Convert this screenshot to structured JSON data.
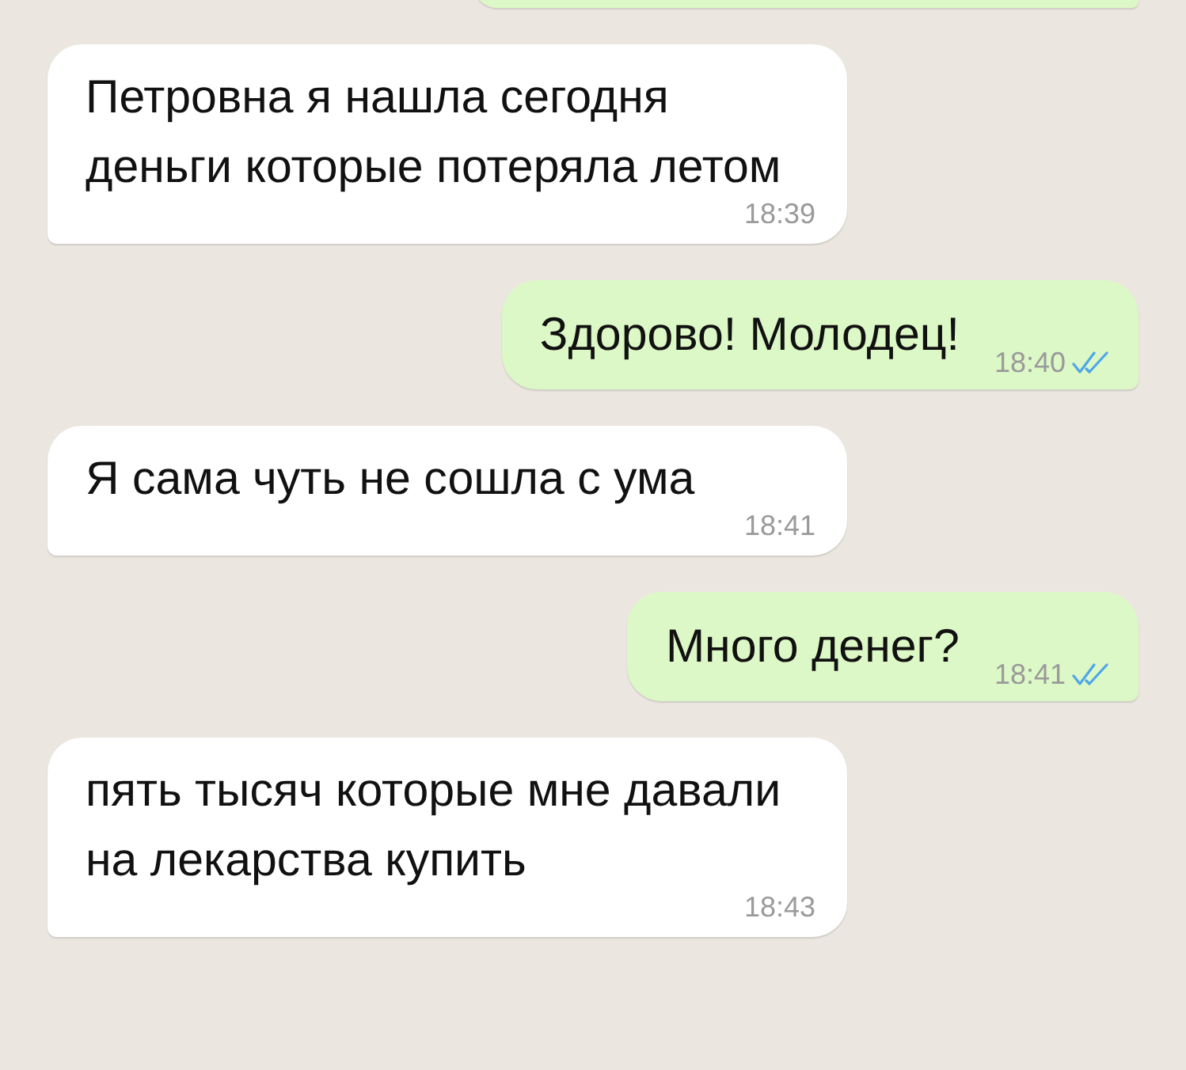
{
  "messages": [
    {
      "kind": "out",
      "cut_off": true
    },
    {
      "kind": "in",
      "text": "Петровна я нашла сегодня деньги которые потеряла летом",
      "time": "18:39"
    },
    {
      "kind": "out",
      "text": "Здорово! Молодец!",
      "time": "18:40",
      "read": true
    },
    {
      "kind": "in",
      "text": "Я сама чуть не сошла с ума",
      "time": "18:41"
    },
    {
      "kind": "out",
      "text": "Много денег?",
      "time": "18:41",
      "read": true
    },
    {
      "kind": "in",
      "text": "пять тысяч которые мне давали на лекарства купить",
      "time": "18:43"
    }
  ]
}
